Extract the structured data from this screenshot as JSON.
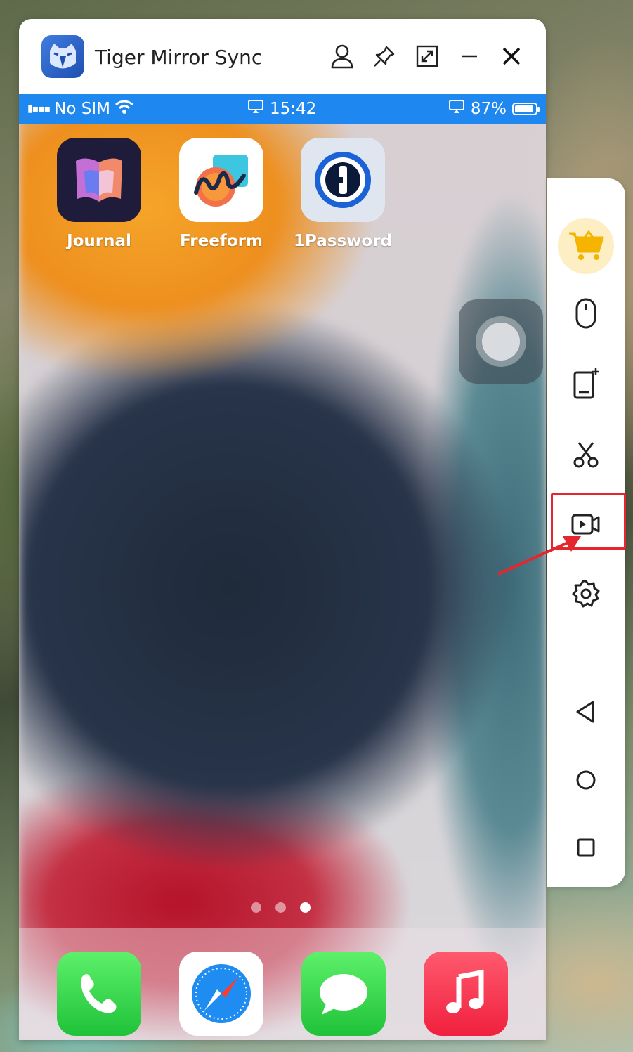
{
  "window": {
    "title": "Tiger Mirror Sync",
    "icons": [
      "account-icon",
      "pin-icon",
      "expand-icon",
      "minimize-icon",
      "close-icon"
    ]
  },
  "statusbar": {
    "carrier": "No SIM",
    "time": "15:42",
    "battery": "87%"
  },
  "home": {
    "apps": [
      {
        "label": "Journal",
        "icon": "journal-icon"
      },
      {
        "label": "Freeform",
        "icon": "freeform-icon"
      },
      {
        "label": "1Password",
        "icon": "onepassword-icon"
      }
    ],
    "page_count": 3,
    "active_page": 3,
    "dock": [
      "phone-icon",
      "safari-icon",
      "messages-icon",
      "music-icon"
    ]
  },
  "sidebar": {
    "buttons": [
      "cart-icon",
      "mouse-icon",
      "device-add-icon",
      "scissors-icon",
      "record-video-icon",
      "settings-icon",
      "back-icon",
      "home-icon",
      "recent-apps-icon"
    ],
    "highlighted": "record-video-icon"
  },
  "colors": {
    "statusbar": "#1e88f0",
    "highlight": "#e6262e",
    "cart_bg": "#fdeec4",
    "cart": "#f5b400"
  }
}
